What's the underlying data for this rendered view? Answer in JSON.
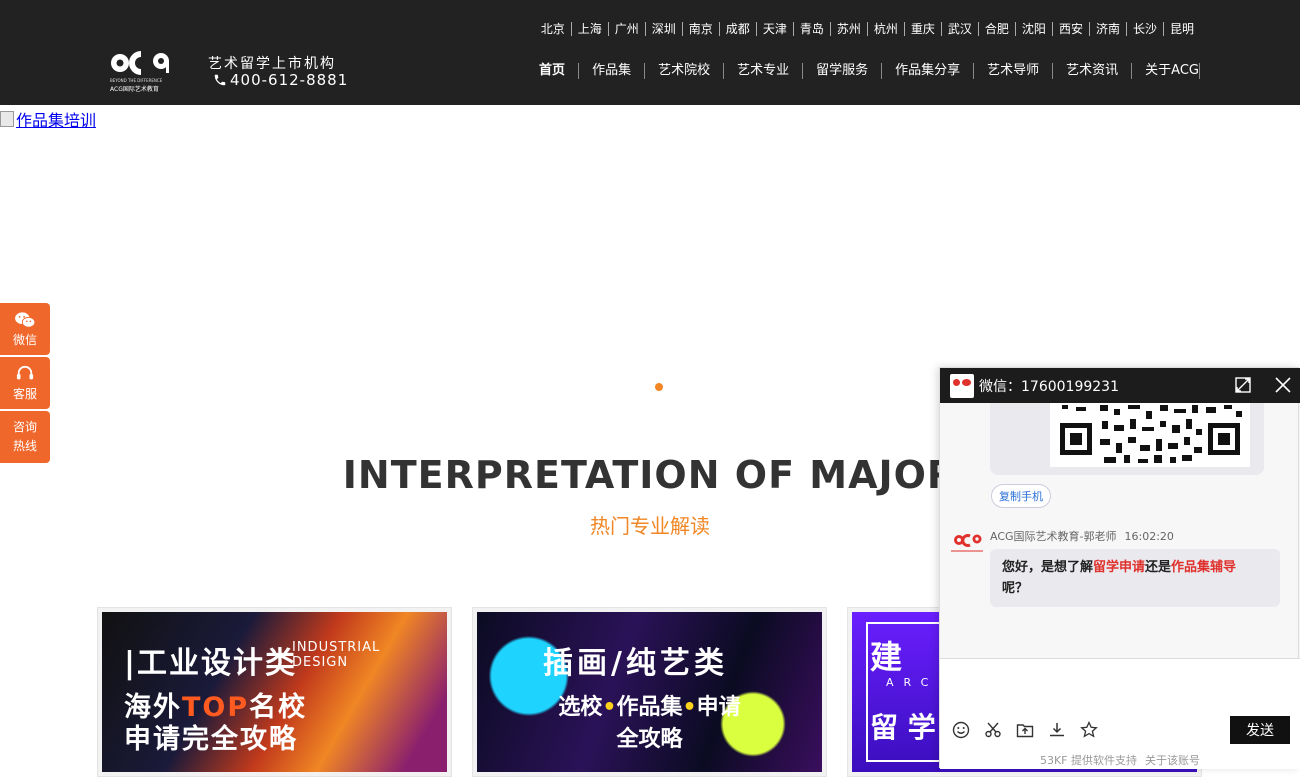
{
  "header": {
    "slogan": "艺术留学上市机构",
    "phone": "400-612-8881",
    "logo_tagline": "BEYOND THE DIFFERENCE",
    "logo_name": "ACG国际艺术教育",
    "cities": [
      "北京",
      "上海",
      "广州",
      "深圳",
      "南京",
      "成都",
      "天津",
      "青岛",
      "苏州",
      "杭州",
      "重庆",
      "武汉",
      "合肥",
      "沈阳",
      "西安",
      "济南",
      "长沙",
      "昆明"
    ],
    "nav": [
      "首页",
      "作品集",
      "艺术院校",
      "艺术专业",
      "留学服务",
      "作品集分享",
      "艺术导师",
      "艺术资讯",
      "关于ACG"
    ]
  },
  "banner": {
    "alt": "作品集培训",
    "accent": "#f08624"
  },
  "side_tabs": [
    {
      "label": "微信",
      "icon": "wechat-icon"
    },
    {
      "label": "客服",
      "icon": "headset-icon"
    },
    {
      "label": "咨询热线",
      "line1": "咨询",
      "line2": "热线"
    }
  ],
  "section": {
    "title_en": "INTERPRETATION OF MAJOR",
    "title_cn": "热门专业解读"
  },
  "cards": [
    {
      "title": "|工业设计类",
      "title_en_1": "INDUSTRIAL",
      "title_en_2": "DESIGN",
      "sub_1a": "海外",
      "sub_1b": "TOP",
      "sub_1c": "名校",
      "sub_2": "申请完全攻略"
    },
    {
      "title": "插画/纯艺类",
      "sub_1a": "选校",
      "sub_1b": "作品集",
      "sub_1c": "申请",
      "sub_2": "全攻略",
      "dot": "•"
    },
    {
      "t1": "建",
      "t2": "ARCH",
      "t3": "留 学"
    }
  ],
  "chat": {
    "title": "微信：17600199231",
    "copy_label": "复制手机",
    "sender": "ACG国际艺术教育-郭老师",
    "time": "16:02:20",
    "msg_a": "您好，是想了解",
    "msg_b": "留学申请",
    "msg_c": "还是",
    "msg_d": "作品集辅导",
    "msg_e": "呢？",
    "send_label": "发送",
    "footer_a": "53KF 提供软件支持",
    "footer_b": "关于该账号",
    "accent": "#e0312c"
  }
}
